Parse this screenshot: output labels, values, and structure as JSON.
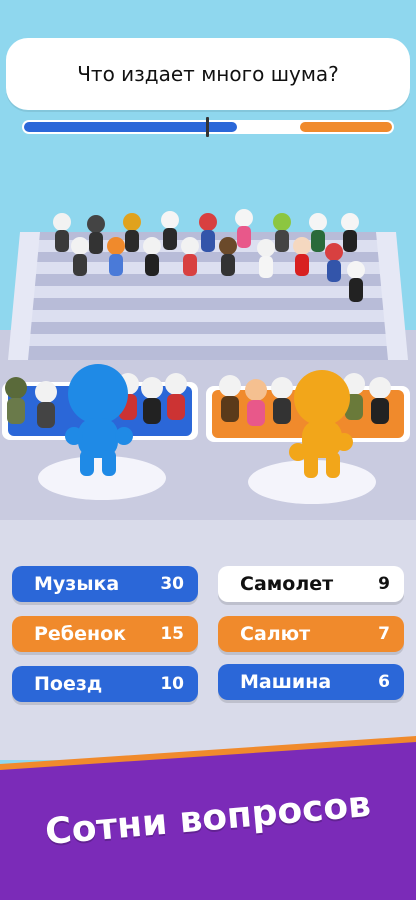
{
  "question": "Что издает много шума?",
  "timer": {
    "blue_fraction": 0.58,
    "orange_fraction": 0.25
  },
  "answers": [
    {
      "label": "Музыка",
      "count": "30",
      "color": "blue"
    },
    {
      "label": "Самолет",
      "count": "9",
      "color": "white"
    },
    {
      "label": "Ребенок",
      "count": "15",
      "color": "orange"
    },
    {
      "label": "Салют",
      "count": "7",
      "color": "orange"
    },
    {
      "label": "Поезд",
      "count": "10",
      "color": "blue"
    },
    {
      "label": "Машина",
      "count": "6",
      "color": "blue"
    }
  ],
  "banner": {
    "text": "Сотни вопросов"
  },
  "colors": {
    "sky": "#8fd7ee",
    "blue_team": "#2b67d8",
    "orange_team": "#f08a2c",
    "banner_purple": "#7b2bb8",
    "banner_stripe": "#f08a2c"
  }
}
